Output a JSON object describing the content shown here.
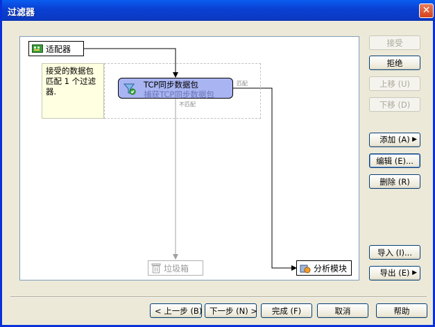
{
  "window": {
    "title": "过滤器",
    "close_glyph": "✕"
  },
  "diagram": {
    "adapter": {
      "label": "适配器",
      "icon": "network-adapter-icon"
    },
    "description": "接受的数据包\n匹配 1 个过滤\n器.",
    "filter": {
      "name": "TCP同步数据包",
      "subtitle": "捕获TCP同步数据包",
      "icon": "filter-funnel-icon"
    },
    "match_label": "匹配",
    "nomatch_label": "不匹配",
    "trash": {
      "label": "垃圾箱",
      "icon": "trash-can-icon"
    },
    "analysis": {
      "label": "分析模块",
      "icon": "analysis-module-icon"
    }
  },
  "side_buttons": {
    "accept": "接受",
    "reject": "拒绝",
    "move_up": "上移 (U)",
    "move_down": "下移 (D)",
    "add": "添加 (A)",
    "edit": "编辑 (E)...",
    "delete": "删除 (R)",
    "import": "导入 (I)...",
    "export": "导出 (E)"
  },
  "footer_buttons": {
    "back": "< 上一步 (B)",
    "next": "下一步 (N) >",
    "finish": "完成 (F)",
    "cancel": "取消",
    "help": "帮助"
  }
}
